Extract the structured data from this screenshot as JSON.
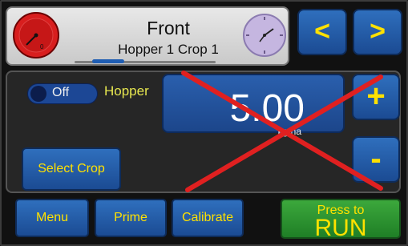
{
  "header": {
    "title": "Front",
    "subtitle": "Hopper 1 Crop 1",
    "gauge_icon": "red-speedometer-gauge",
    "clock_icon": "purple-analog-clock"
  },
  "nav": {
    "prev_label": "<",
    "next_label": ">"
  },
  "main": {
    "toggle_label": "Off",
    "hopper_label": "Hopper",
    "value": "5.00",
    "unit": "kg/ha",
    "plus_label": "+",
    "minus_label": "-",
    "select_crop_label": "Select Crop",
    "cross_color": "#e02020"
  },
  "bottom": {
    "menu_label": "Menu",
    "prime_label": "Prime",
    "calibrate_label": "Calibrate",
    "run_top": "Press to",
    "run_main": "RUN"
  },
  "colors": {
    "accent_text": "#ffe100",
    "button_blue": "#2a5fad",
    "run_green": "#2f9a35"
  }
}
